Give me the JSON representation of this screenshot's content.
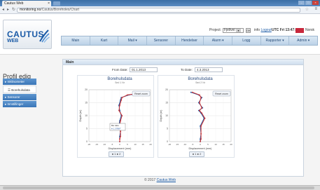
{
  "browser": {
    "tab_title": "Cautus Web",
    "url_host": "monitoring.no",
    "url_path": "/Cautus/Boreholes/Chart"
  },
  "logo": {
    "name": "CAUTUS",
    "sub": "WEB"
  },
  "header": {
    "project_label": "Project:",
    "project_value": "Fjellvei",
    "go_label": "OK",
    "user_prefix": "info",
    "logout": "Logout",
    "utc": "UTC Fri 13:47:23",
    "language": "Norsk"
  },
  "nav": [
    "Main",
    "Kart",
    "Mail ▾",
    "Sensorer",
    "Hendelser",
    "Alarm ▾",
    "Logg",
    "Rapporter ▾",
    "Admin ▾"
  ],
  "page_title": "Profil edig",
  "sidebar": {
    "items": [
      "▸ Inklinometer",
      "☰ Borehulsdata",
      "▸ Sensorer",
      "▸ Innstillinger"
    ]
  },
  "main": {
    "header": "Main",
    "from_label": "From Date:",
    "from_value": "01.1.2013",
    "to_label": "To Date:",
    "to_value": "4.3.2013"
  },
  "charts": [
    {
      "title": "Borehulsdata",
      "subtitle": "Sed 1 Nr",
      "xlabel": "Displacement (mm)",
      "ylabel": "Depth (m)",
      "reset_label": "Reset zoom",
      "tooltip_title": "Bw date",
      "tooltip_value": "● 1.37887",
      "legend": "● 1  ● 2"
    },
    {
      "title": "Borehulsdata",
      "subtitle": "Sed 2 Nr",
      "xlabel": "Displacement (mm)",
      "ylabel": "Depth (m)",
      "reset_label": "Reset zoom",
      "legend": "● 1  ● 2"
    }
  ],
  "chart_data": [
    {
      "type": "line",
      "title": "Borehulsdata",
      "xlabel": "Displacement (mm)",
      "ylabel": "Depth (m)",
      "xlim": [
        -20,
        20
      ],
      "ylim": [
        0,
        20
      ],
      "xticks": [
        "-20",
        "-15",
        "-10",
        "-5",
        "0",
        "5",
        "10",
        "15",
        "20"
      ],
      "yticks": [
        "20",
        "15",
        "10",
        "5",
        "0"
      ],
      "series": [
        {
          "name": "1",
          "color": "#1a4f9a",
          "x": [
            18,
            6,
            1,
            0.5,
            -0.5,
            0,
            1,
            0,
            -0.5,
            0.5,
            0,
            0,
            0
          ],
          "y": [
            19,
            18,
            17,
            16,
            14,
            12,
            10,
            8,
            6,
            4,
            2,
            1,
            0
          ]
        },
        {
          "name": "2",
          "color": "#d03030",
          "x": [
            17,
            5,
            1.5,
            1,
            0,
            -0.5,
            1.5,
            0.5,
            0,
            0.5,
            0.5,
            0,
            0
          ],
          "y": [
            19,
            18,
            17,
            16,
            14,
            12,
            10,
            8,
            6,
            4,
            2,
            1,
            0
          ]
        }
      ]
    },
    {
      "type": "line",
      "title": "Borehulsdata",
      "xlabel": "Displacement (mm)",
      "ylabel": "Depth (m)",
      "xlim": [
        -20,
        20
      ],
      "ylim": [
        0,
        20
      ],
      "xticks": [
        "-20",
        "-15",
        "-10",
        "-5",
        "0",
        "5",
        "10",
        "15",
        "20"
      ],
      "yticks": [
        "20",
        "15",
        "10",
        "5",
        "0"
      ],
      "series": [
        {
          "name": "1",
          "color": "#1a4f9a",
          "x": [
            -6,
            -1,
            1,
            -1,
            1.5,
            -1,
            0.5,
            2.5,
            0,
            0.5,
            0,
            0
          ],
          "y": [
            19,
            18,
            17,
            15,
            13,
            12,
            11,
            9,
            6,
            3,
            1,
            0
          ]
        },
        {
          "name": "2",
          "color": "#d03030",
          "x": [
            -5,
            -0.5,
            0.5,
            -0.5,
            1,
            -0.5,
            1,
            3,
            0.5,
            0.5,
            0.5,
            0
          ],
          "y": [
            19,
            18,
            17,
            15,
            13,
            12,
            11,
            9,
            6,
            3,
            1,
            0
          ]
        }
      ]
    }
  ],
  "footer": {
    "prefix": "© 2017",
    "link": "Cautus.Web"
  }
}
